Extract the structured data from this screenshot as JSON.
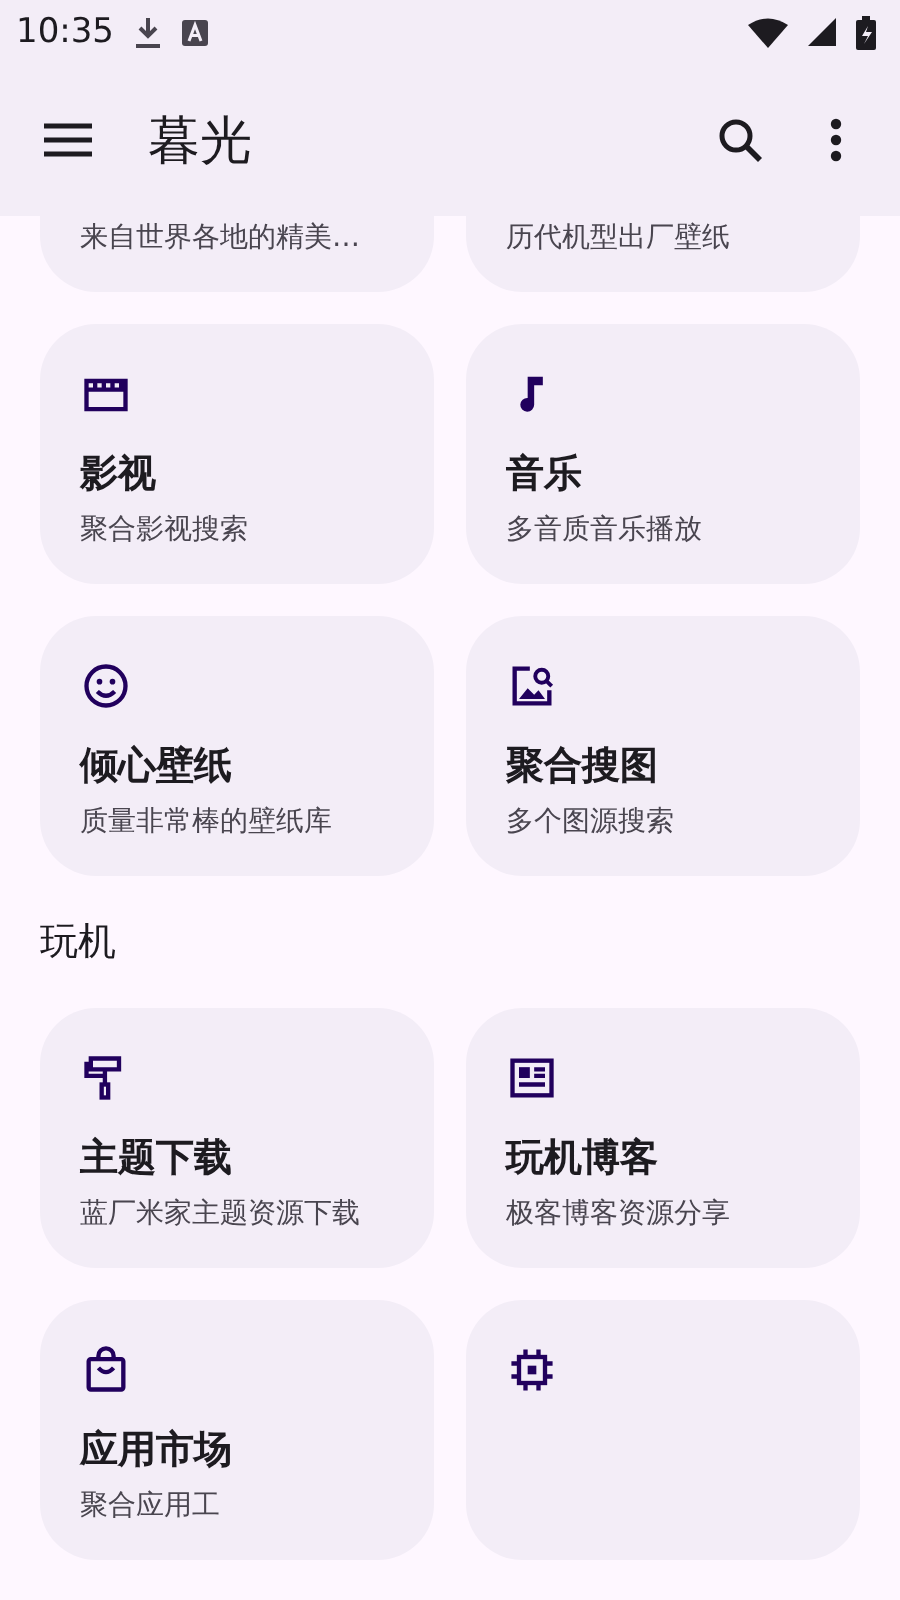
{
  "status_bar": {
    "time": "10:35"
  },
  "app_bar": {
    "title": "暮光"
  },
  "partial_cards": [
    {
      "subtitle": "来自世界各地的精美…"
    },
    {
      "subtitle": "历代机型出厂壁纸"
    }
  ],
  "sections": [
    {
      "cards": [
        {
          "kind": "movie",
          "title": "影视",
          "subtitle": "聚合影视搜索"
        },
        {
          "kind": "music",
          "title": "音乐",
          "subtitle": "多音质音乐播放"
        },
        {
          "kind": "smile",
          "title": "倾心壁纸",
          "subtitle": "质量非常棒的壁纸库"
        },
        {
          "kind": "image-search",
          "title": "聚合搜图",
          "subtitle": "多个图源搜索"
        }
      ]
    },
    {
      "title": "玩机",
      "cards": [
        {
          "kind": "roller",
          "title": "主题下载",
          "subtitle": "蓝厂米家主题资源下载"
        },
        {
          "kind": "article",
          "title": "玩机博客",
          "subtitle": "极客博客资源分享"
        },
        {
          "kind": "bag",
          "title": "应用市场",
          "subtitle": "聚合应用工"
        },
        {
          "kind": "chip"
        }
      ]
    }
  ]
}
